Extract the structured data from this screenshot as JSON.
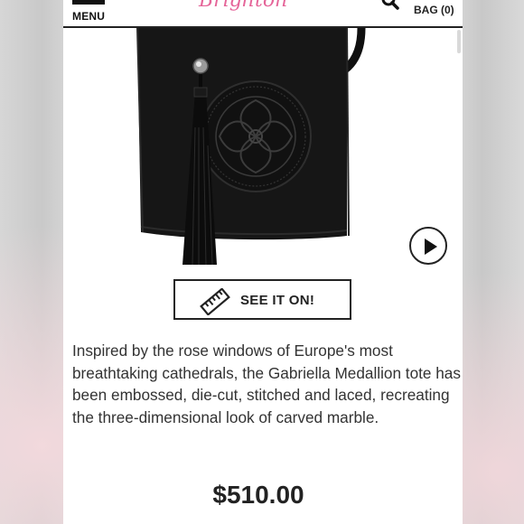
{
  "header": {
    "menu_label": "MENU",
    "logo_text": "Brighton",
    "bag_label": "BAG (0)"
  },
  "product": {
    "image_alt": "Gabriella Medallion tote, black leather with tassel",
    "play_icon": "play-icon",
    "see_it_on_label": "SEE IT ON!",
    "see_it_on_icon": "ruler-icon",
    "description": "Inspired by the rose windows of Europe's most breathtaking cathedrals, the Gabriella Medallion tote has been embossed, die-cut, stitched and laced, recreating the three-dimensional look of carved marble.",
    "price": "$510.00"
  },
  "colors": {
    "accent_logo": "#e3558f",
    "text_dark": "#222222",
    "text_body": "#333333",
    "bag_black": "#151515"
  }
}
